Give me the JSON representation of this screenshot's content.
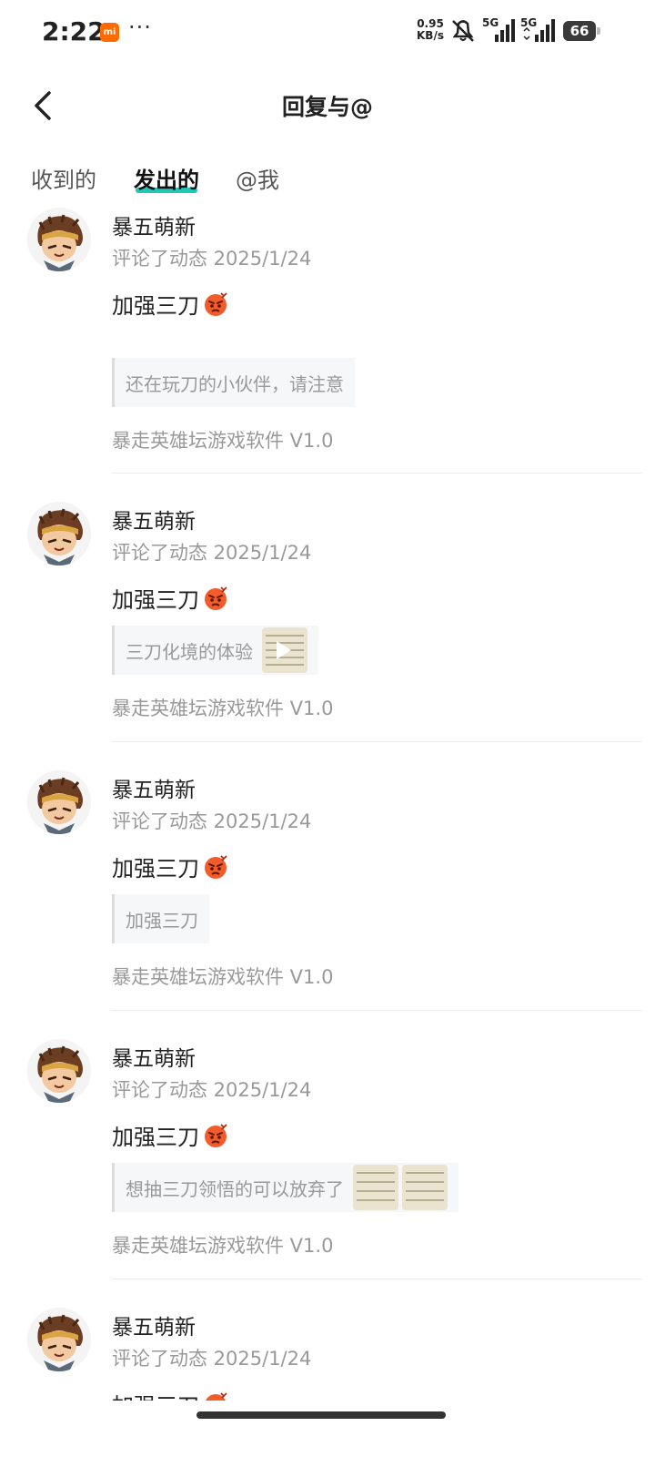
{
  "status_bar": {
    "time": "2:22",
    "mi_badge": "mi",
    "more": "···",
    "speed_value": "0.95",
    "speed_unit": "KB/s",
    "net1": "5G",
    "net2": "5G",
    "battery": "66"
  },
  "header": {
    "title": "回复与@",
    "back_icon": "chevron-left-icon"
  },
  "tabs": [
    {
      "label": "收到的",
      "active": false
    },
    {
      "label": "发出的",
      "active": true
    },
    {
      "label": "@我",
      "active": false
    }
  ],
  "accent_color": "#21c8b8",
  "comments": [
    {
      "user": "暴五萌新",
      "meta": "评论了动态 2025/1/24",
      "content": "加强三刀",
      "quote": "还在玩刀的小伙伴，请注意",
      "thumbs": "none",
      "source": "暴走英雄坛游戏软件 V1.0"
    },
    {
      "user": "暴五萌新",
      "meta": "评论了动态 2025/1/24",
      "content": "加强三刀",
      "quote": "三刀化境的体验",
      "thumbs": "video",
      "source": "暴走英雄坛游戏软件 V1.0"
    },
    {
      "user": "暴五萌新",
      "meta": "评论了动态 2025/1/24",
      "content": "加强三刀",
      "quote": "加强三刀",
      "thumbs": "none",
      "source": "暴走英雄坛游戏软件 V1.0"
    },
    {
      "user": "暴五萌新",
      "meta": "评论了动态 2025/1/24",
      "content": "加强三刀",
      "quote": "想抽三刀领悟的可以放弃了",
      "thumbs": "two-images",
      "source": "暴走英雄坛游戏软件 V1.0"
    },
    {
      "user": "暴五萌新",
      "meta": "评论了动态 2025/1/24",
      "content": "加强三刀"
    }
  ]
}
